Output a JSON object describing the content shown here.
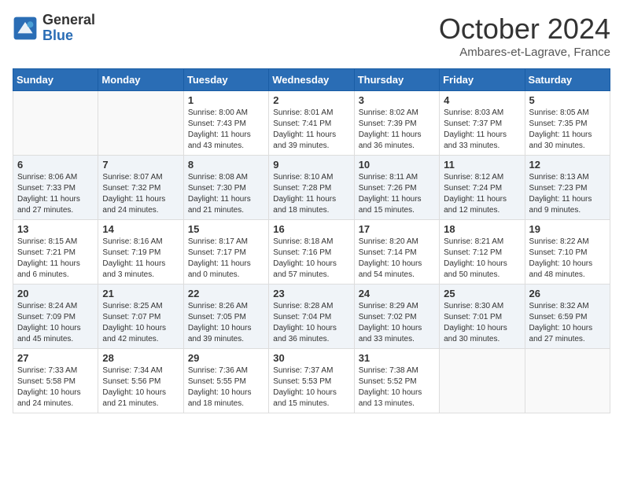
{
  "logo": {
    "general": "General",
    "blue": "Blue"
  },
  "header": {
    "month": "October 2024",
    "location": "Ambares-et-Lagrave, France"
  },
  "weekdays": [
    "Sunday",
    "Monday",
    "Tuesday",
    "Wednesday",
    "Thursday",
    "Friday",
    "Saturday"
  ],
  "weeks": [
    [
      {
        "day": "",
        "sunrise": "",
        "sunset": "",
        "daylight": ""
      },
      {
        "day": "",
        "sunrise": "",
        "sunset": "",
        "daylight": ""
      },
      {
        "day": "1",
        "sunrise": "Sunrise: 8:00 AM",
        "sunset": "Sunset: 7:43 PM",
        "daylight": "Daylight: 11 hours and 43 minutes."
      },
      {
        "day": "2",
        "sunrise": "Sunrise: 8:01 AM",
        "sunset": "Sunset: 7:41 PM",
        "daylight": "Daylight: 11 hours and 39 minutes."
      },
      {
        "day": "3",
        "sunrise": "Sunrise: 8:02 AM",
        "sunset": "Sunset: 7:39 PM",
        "daylight": "Daylight: 11 hours and 36 minutes."
      },
      {
        "day": "4",
        "sunrise": "Sunrise: 8:03 AM",
        "sunset": "Sunset: 7:37 PM",
        "daylight": "Daylight: 11 hours and 33 minutes."
      },
      {
        "day": "5",
        "sunrise": "Sunrise: 8:05 AM",
        "sunset": "Sunset: 7:35 PM",
        "daylight": "Daylight: 11 hours and 30 minutes."
      }
    ],
    [
      {
        "day": "6",
        "sunrise": "Sunrise: 8:06 AM",
        "sunset": "Sunset: 7:33 PM",
        "daylight": "Daylight: 11 hours and 27 minutes."
      },
      {
        "day": "7",
        "sunrise": "Sunrise: 8:07 AM",
        "sunset": "Sunset: 7:32 PM",
        "daylight": "Daylight: 11 hours and 24 minutes."
      },
      {
        "day": "8",
        "sunrise": "Sunrise: 8:08 AM",
        "sunset": "Sunset: 7:30 PM",
        "daylight": "Daylight: 11 hours and 21 minutes."
      },
      {
        "day": "9",
        "sunrise": "Sunrise: 8:10 AM",
        "sunset": "Sunset: 7:28 PM",
        "daylight": "Daylight: 11 hours and 18 minutes."
      },
      {
        "day": "10",
        "sunrise": "Sunrise: 8:11 AM",
        "sunset": "Sunset: 7:26 PM",
        "daylight": "Daylight: 11 hours and 15 minutes."
      },
      {
        "day": "11",
        "sunrise": "Sunrise: 8:12 AM",
        "sunset": "Sunset: 7:24 PM",
        "daylight": "Daylight: 11 hours and 12 minutes."
      },
      {
        "day": "12",
        "sunrise": "Sunrise: 8:13 AM",
        "sunset": "Sunset: 7:23 PM",
        "daylight": "Daylight: 11 hours and 9 minutes."
      }
    ],
    [
      {
        "day": "13",
        "sunrise": "Sunrise: 8:15 AM",
        "sunset": "Sunset: 7:21 PM",
        "daylight": "Daylight: 11 hours and 6 minutes."
      },
      {
        "day": "14",
        "sunrise": "Sunrise: 8:16 AM",
        "sunset": "Sunset: 7:19 PM",
        "daylight": "Daylight: 11 hours and 3 minutes."
      },
      {
        "day": "15",
        "sunrise": "Sunrise: 8:17 AM",
        "sunset": "Sunset: 7:17 PM",
        "daylight": "Daylight: 11 hours and 0 minutes."
      },
      {
        "day": "16",
        "sunrise": "Sunrise: 8:18 AM",
        "sunset": "Sunset: 7:16 PM",
        "daylight": "Daylight: 10 hours and 57 minutes."
      },
      {
        "day": "17",
        "sunrise": "Sunrise: 8:20 AM",
        "sunset": "Sunset: 7:14 PM",
        "daylight": "Daylight: 10 hours and 54 minutes."
      },
      {
        "day": "18",
        "sunrise": "Sunrise: 8:21 AM",
        "sunset": "Sunset: 7:12 PM",
        "daylight": "Daylight: 10 hours and 50 minutes."
      },
      {
        "day": "19",
        "sunrise": "Sunrise: 8:22 AM",
        "sunset": "Sunset: 7:10 PM",
        "daylight": "Daylight: 10 hours and 48 minutes."
      }
    ],
    [
      {
        "day": "20",
        "sunrise": "Sunrise: 8:24 AM",
        "sunset": "Sunset: 7:09 PM",
        "daylight": "Daylight: 10 hours and 45 minutes."
      },
      {
        "day": "21",
        "sunrise": "Sunrise: 8:25 AM",
        "sunset": "Sunset: 7:07 PM",
        "daylight": "Daylight: 10 hours and 42 minutes."
      },
      {
        "day": "22",
        "sunrise": "Sunrise: 8:26 AM",
        "sunset": "Sunset: 7:05 PM",
        "daylight": "Daylight: 10 hours and 39 minutes."
      },
      {
        "day": "23",
        "sunrise": "Sunrise: 8:28 AM",
        "sunset": "Sunset: 7:04 PM",
        "daylight": "Daylight: 10 hours and 36 minutes."
      },
      {
        "day": "24",
        "sunrise": "Sunrise: 8:29 AM",
        "sunset": "Sunset: 7:02 PM",
        "daylight": "Daylight: 10 hours and 33 minutes."
      },
      {
        "day": "25",
        "sunrise": "Sunrise: 8:30 AM",
        "sunset": "Sunset: 7:01 PM",
        "daylight": "Daylight: 10 hours and 30 minutes."
      },
      {
        "day": "26",
        "sunrise": "Sunrise: 8:32 AM",
        "sunset": "Sunset: 6:59 PM",
        "daylight": "Daylight: 10 hours and 27 minutes."
      }
    ],
    [
      {
        "day": "27",
        "sunrise": "Sunrise: 7:33 AM",
        "sunset": "Sunset: 5:58 PM",
        "daylight": "Daylight: 10 hours and 24 minutes."
      },
      {
        "day": "28",
        "sunrise": "Sunrise: 7:34 AM",
        "sunset": "Sunset: 5:56 PM",
        "daylight": "Daylight: 10 hours and 21 minutes."
      },
      {
        "day": "29",
        "sunrise": "Sunrise: 7:36 AM",
        "sunset": "Sunset: 5:55 PM",
        "daylight": "Daylight: 10 hours and 18 minutes."
      },
      {
        "day": "30",
        "sunrise": "Sunrise: 7:37 AM",
        "sunset": "Sunset: 5:53 PM",
        "daylight": "Daylight: 10 hours and 15 minutes."
      },
      {
        "day": "31",
        "sunrise": "Sunrise: 7:38 AM",
        "sunset": "Sunset: 5:52 PM",
        "daylight": "Daylight: 10 hours and 13 minutes."
      },
      {
        "day": "",
        "sunrise": "",
        "sunset": "",
        "daylight": ""
      },
      {
        "day": "",
        "sunrise": "",
        "sunset": "",
        "daylight": ""
      }
    ]
  ]
}
